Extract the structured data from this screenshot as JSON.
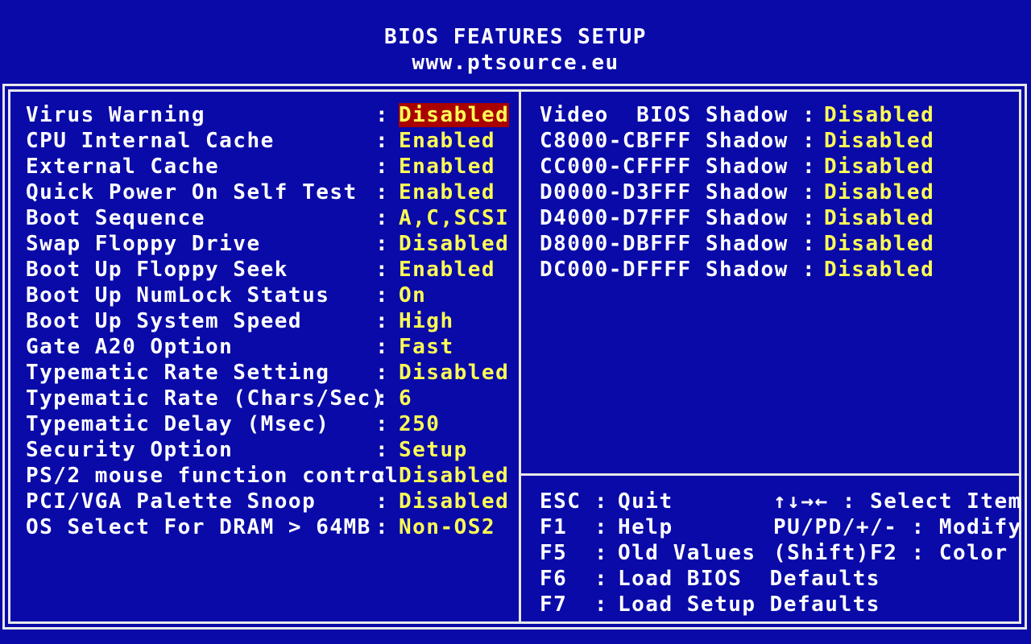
{
  "header": {
    "title": "BIOS FEATURES SETUP",
    "subtitle": "www.ptsource.eu"
  },
  "left_settings": [
    {
      "label": "Virus Warning",
      "value": "Disabled",
      "selected": true
    },
    {
      "label": "CPU Internal Cache",
      "value": "Enabled"
    },
    {
      "label": "External Cache",
      "value": "Enabled"
    },
    {
      "label": "Quick Power On Self Test",
      "value": "Enabled"
    },
    {
      "label": "Boot Sequence",
      "value": "A,C,SCSI"
    },
    {
      "label": "Swap Floppy Drive",
      "value": "Disabled"
    },
    {
      "label": "Boot Up Floppy Seek",
      "value": "Enabled"
    },
    {
      "label": "Boot Up NumLock Status",
      "value": "On"
    },
    {
      "label": "Boot Up System Speed",
      "value": "High"
    },
    {
      "label": "Gate A20 Option",
      "value": "Fast"
    },
    {
      "label": "Typematic Rate Setting",
      "value": "Disabled"
    },
    {
      "label": "Typematic Rate (Chars/Sec)",
      "value": "6"
    },
    {
      "label": "Typematic Delay (Msec)",
      "value": "250"
    },
    {
      "label": "Security Option",
      "value": "Setup"
    },
    {
      "label": "PS/2 mouse function control",
      "value": "Disabled"
    },
    {
      "label": "PCI/VGA Palette Snoop",
      "value": "Disabled"
    },
    {
      "label": "OS Select For DRAM > 64MB",
      "value": "Non-OS2"
    }
  ],
  "right_settings": [
    {
      "label": "Video  BIOS Shadow",
      "value": "Disabled"
    },
    {
      "label": "C8000-CBFFF Shadow",
      "value": "Disabled"
    },
    {
      "label": "CC000-CFFFF Shadow",
      "value": "Disabled"
    },
    {
      "label": "D0000-D3FFF Shadow",
      "value": "Disabled"
    },
    {
      "label": "D4000-D7FFF Shadow",
      "value": "Disabled"
    },
    {
      "label": "D8000-DBFFF Shadow",
      "value": "Disabled"
    },
    {
      "label": "DC000-DFFFF Shadow",
      "value": "Disabled"
    }
  ],
  "help": [
    {
      "key": "ESC",
      "text": "Quit",
      "rtext": "↑↓→← : Select Item"
    },
    {
      "key": "F1",
      "text": "Help",
      "rtext": "PU/PD/+/- : Modify"
    },
    {
      "key": "F5",
      "text": "Old Values",
      "rtext": "(Shift)F2 : Color"
    },
    {
      "key": "F6",
      "text": "Load BIOS  Defaults",
      "rtext": ""
    },
    {
      "key": "F7",
      "text": "Load Setup Defaults",
      "rtext": ""
    }
  ],
  "colon": ":",
  "colors": {
    "background": "#0a0aa8",
    "label": "#ffffff",
    "value": "#ffff55",
    "selected_bg": "#aa0000",
    "frame": "#e8e8e8"
  }
}
